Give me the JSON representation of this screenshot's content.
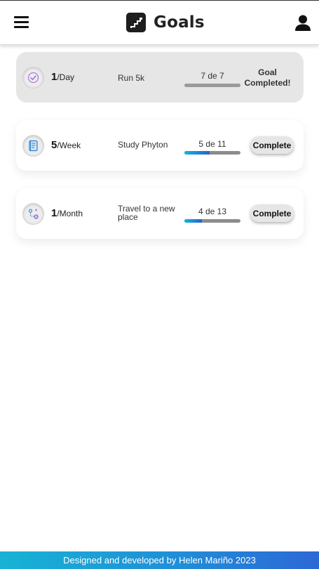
{
  "header": {
    "title": "Goals",
    "menu_icon": "hamburger-menu-icon",
    "logo_icon": "stairs-logo-icon",
    "user_icon": "user-icon"
  },
  "goals": [
    {
      "icon": "checkmark-circle-icon",
      "frequency": "1",
      "period": "/Day",
      "name": "Run 5k",
      "progress_text": "7 de 7",
      "done": 7,
      "total": 7,
      "status": "Goal Completed!",
      "status_line1": "Goal",
      "status_line2": "Completed!"
    },
    {
      "icon": "book-icon",
      "frequency": "5",
      "period": "/Week",
      "name": "Study Phyton",
      "progress_text": "5 de 11",
      "done": 5,
      "total": 11,
      "button": "Complete"
    },
    {
      "icon": "travel-route-icon",
      "frequency": "1",
      "period": "/Month",
      "name": "Travel to a new place",
      "progress_text": "4 de 13",
      "done": 4,
      "total": 13,
      "button": "Complete"
    }
  ],
  "footer": {
    "text": "Designed and developed by Helen Mariño 2023"
  },
  "colors": {
    "progress_start": "#14b4e0",
    "progress_end": "#2a62c8",
    "footer_start": "#17b3d4",
    "footer_end": "#2d67d6"
  }
}
